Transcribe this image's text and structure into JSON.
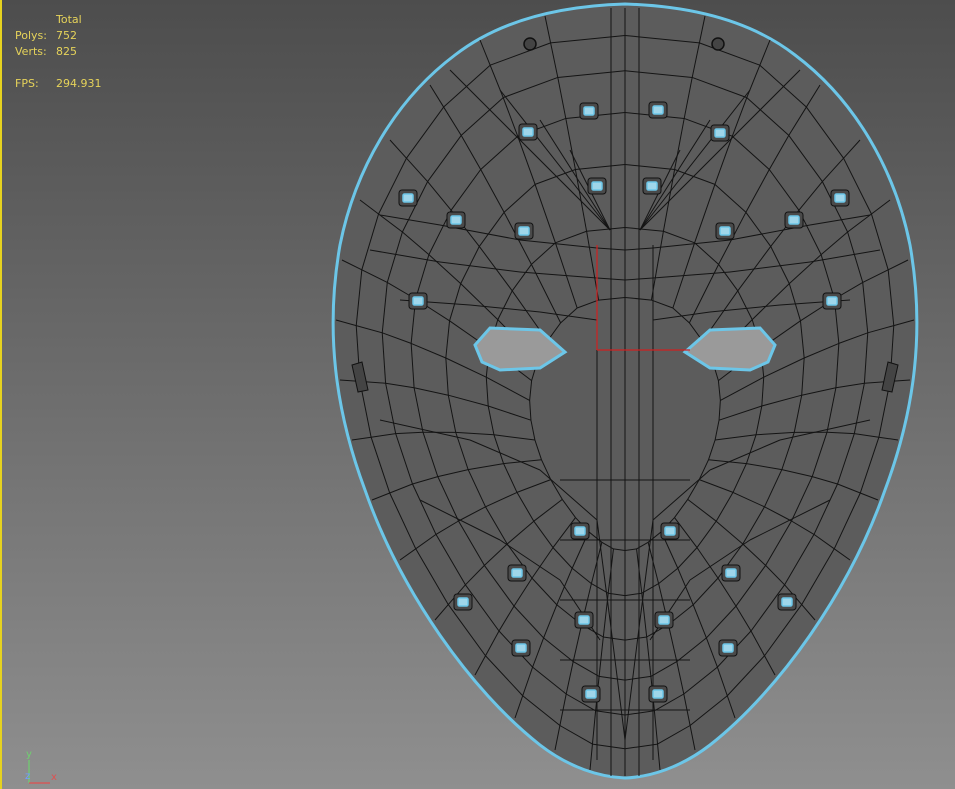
{
  "stats": {
    "header": "Total",
    "polys_label": "Polys:",
    "polys_value": "752",
    "verts_label": "Verts:",
    "verts_value": "825",
    "fps_label": "FPS:",
    "fps_value": "294.931"
  },
  "axis": {
    "y": "y",
    "z": "z",
    "x": "x"
  },
  "colors": {
    "mesh_fill": "#5c5c5c",
    "wire": "#111111",
    "selection_edge": "#6cc6e8",
    "stats_text": "#e6d35a",
    "pivot": "#d02020",
    "viewport_border": "#e6d21f"
  }
}
